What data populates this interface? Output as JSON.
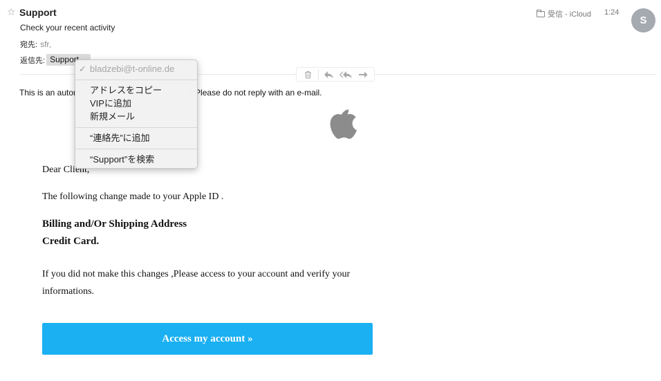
{
  "header": {
    "star_glyph": "☆",
    "sender": "Support",
    "subject": "Check your recent activity",
    "to_label": "宛先:",
    "to_value": "sfr,",
    "reply_label": "返信先:",
    "reply_value": "Support",
    "mailbox": "受信 - iCloud",
    "time": "1:24",
    "avatar_initial": "S"
  },
  "toolbar": {
    "icons": [
      "trash-icon",
      "reply-icon",
      "reply-all-icon",
      "forward-icon"
    ]
  },
  "body": {
    "auto_text_start": "This is an autom",
    "auto_text_end": "n,Please do not reply with an e-mail.",
    "dear": "Dear Client,",
    "following": "The following change made to your Apple ID .",
    "billing": "Billing and/Or Shipping Address",
    "credit": "Credit Card.",
    "ifyou": "If you did not make this changes ,Please access to your account and verify your informations.",
    "button_label": "Access my account »",
    "button_color": "#1ab0f2"
  },
  "context_menu": {
    "check_glyph": "✓",
    "email": "bladzebi@t-online.de",
    "copy_address": "アドレスをコピー",
    "add_vip": "VIPに追加",
    "new_mail": "新規メール",
    "add_contacts": "“連絡先”に追加",
    "search_support": "“Support”を検索"
  }
}
